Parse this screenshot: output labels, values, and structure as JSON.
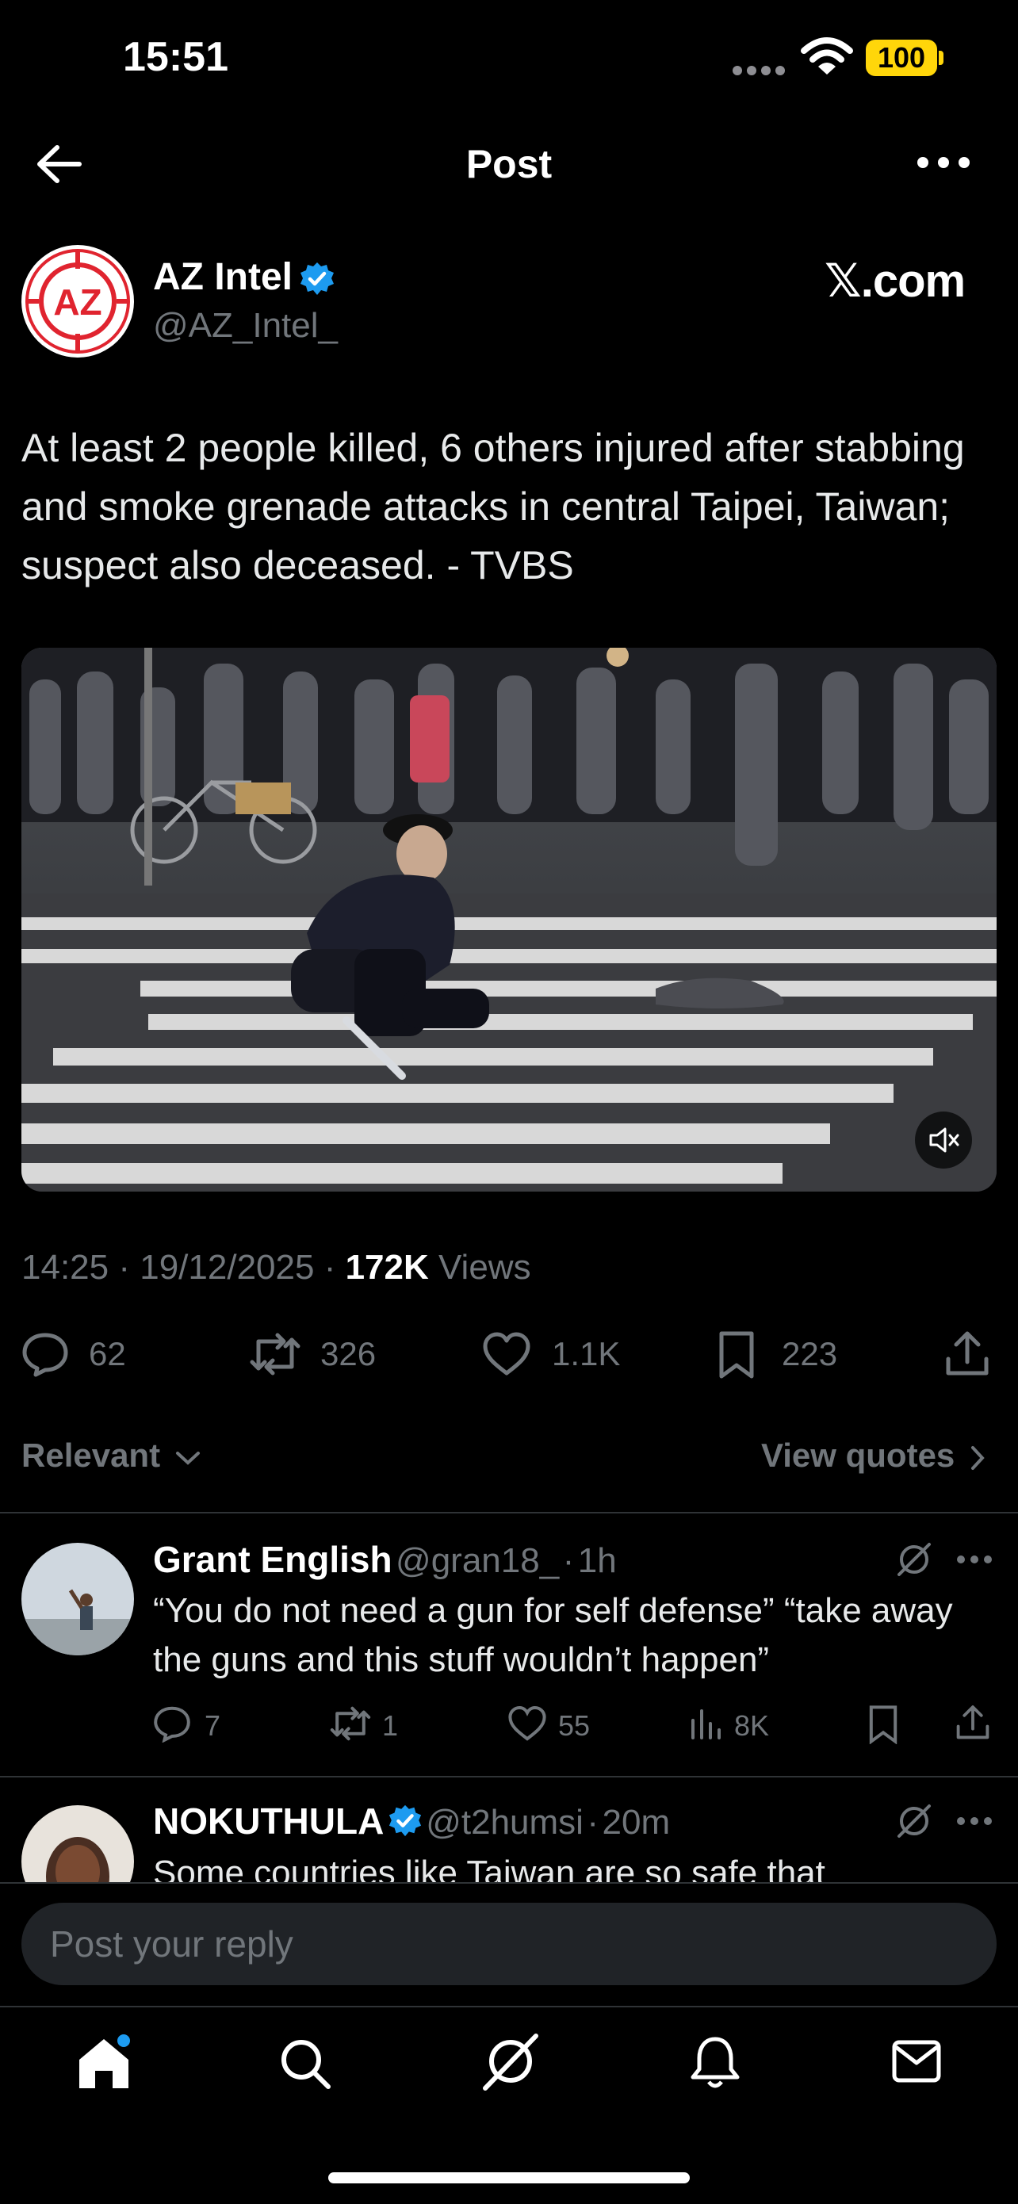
{
  "status_bar": {
    "time": "15:51",
    "battery": "100"
  },
  "header": {
    "title": "Post"
  },
  "author": {
    "name": "AZ Intel",
    "handle": "@AZ_Intel_",
    "avatar_text": "AZ",
    "watermark": "𝕏.com"
  },
  "tweet": {
    "text": "At least 2 people killed, 6 others injured after stabbing and smoke grenade attacks in central Taipei, Taiwan; suspect also deceased. - TVBS",
    "time": "14:25",
    "date": "19/12/2025",
    "views_count": "172K",
    "views_label": "Views"
  },
  "actions": {
    "replies": "62",
    "reposts": "326",
    "likes": "1.1K",
    "bookmarks": "223"
  },
  "replies_bar": {
    "sort": "Relevant",
    "view_quotes": "View quotes"
  },
  "replies": [
    {
      "name": "Grant English",
      "handle": "@gran18_",
      "time": "1h",
      "text": "“You do not need a gun for self defense” “take away the guns and this stuff wouldn’t happen”",
      "replies": "7",
      "reposts": "1",
      "likes": "55",
      "views": "8K"
    },
    {
      "name": "NOKUTHULA",
      "handle": "@t2humsi",
      "time": "20m",
      "text": "Some countries like Taiwan are so safe that"
    }
  ],
  "composer": {
    "placeholder": "Post your reply"
  },
  "colors": {
    "accent": "#1d9bf0",
    "muted": "#71767b",
    "brand_red": "#e0242f",
    "battery": "#ffd60a"
  },
  "icons": [
    "back-arrow-icon",
    "more-icon",
    "verified-icon",
    "mute-icon",
    "reply-icon",
    "repost-icon",
    "like-icon",
    "bookmark-icon",
    "share-icon",
    "grok-icon",
    "views-icon",
    "home-icon",
    "search-icon",
    "notifications-icon",
    "messages-icon"
  ]
}
